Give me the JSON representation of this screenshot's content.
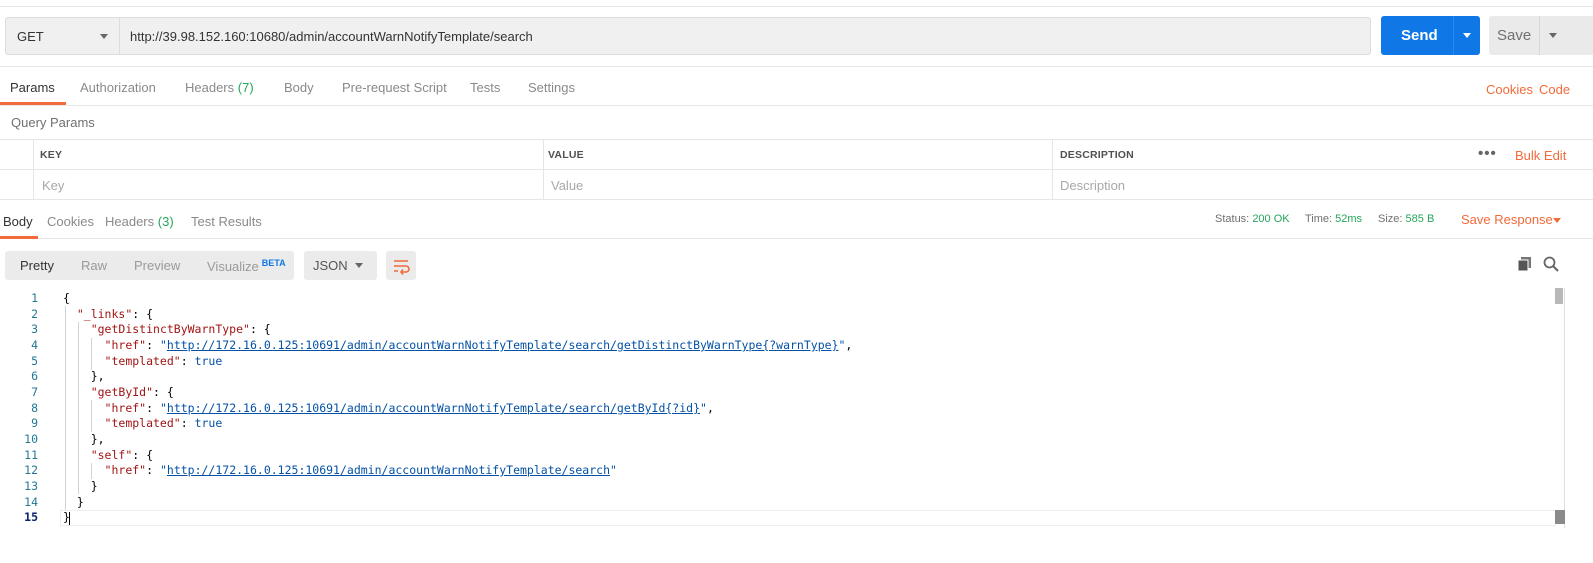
{
  "request": {
    "method": "GET",
    "url": "http://39.98.152.160:10680/admin/accountWarnNotifyTemplate/search",
    "send_label": "Send",
    "save_label": "Save"
  },
  "request_tabs": [
    {
      "label": "Params",
      "count": ""
    },
    {
      "label": "Authorization",
      "count": ""
    },
    {
      "label": "Headers",
      "count": "(7)"
    },
    {
      "label": "Body",
      "count": ""
    },
    {
      "label": "Pre-request Script",
      "count": ""
    },
    {
      "label": "Tests",
      "count": ""
    },
    {
      "label": "Settings",
      "count": ""
    }
  ],
  "request_links": {
    "cookies": "Cookies",
    "code": "Code"
  },
  "query_params": {
    "title": "Query Params",
    "headers": {
      "key": "KEY",
      "value": "VALUE",
      "description": "DESCRIPTION"
    },
    "placeholders": {
      "key": "Key",
      "value": "Value",
      "description": "Description"
    },
    "more": "•••",
    "bulk_edit": "Bulk Edit"
  },
  "response_tabs": [
    {
      "label": "Body",
      "count": ""
    },
    {
      "label": "Cookies",
      "count": ""
    },
    {
      "label": "Headers",
      "count": "(3)"
    },
    {
      "label": "Test Results",
      "count": ""
    }
  ],
  "response_status": {
    "status_label": "Status:",
    "status_value": "200 OK",
    "time_label": "Time:",
    "time_value": "52ms",
    "size_label": "Size:",
    "size_value": "585 B",
    "save_response": "Save Response"
  },
  "viewer": {
    "modes": [
      "Pretty",
      "Raw",
      "Preview",
      "Visualize"
    ],
    "beta": "BETA",
    "format": "JSON"
  },
  "code_lines": [
    "1",
    "2",
    "3",
    "4",
    "5",
    "6",
    "7",
    "8",
    "9",
    "10",
    "11",
    "12",
    "13",
    "14",
    "15"
  ],
  "json": {
    "links_key": "\"_links\"",
    "get_distinct_key": "\"getDistinctByWarnType\"",
    "get_by_id_key": "\"getById\"",
    "self_key": "\"self\"",
    "href_key": "\"href\"",
    "templated_key": "\"templated\"",
    "true_val": "true",
    "href_distinct": "http://172.16.0.125:10691/admin/accountWarnNotifyTemplate/search/getDistinctByWarnType{?warnType}",
    "href_by_id": "http://172.16.0.125:10691/admin/accountWarnNotifyTemplate/search/getById{?id}",
    "href_self": "http://172.16.0.125:10691/admin/accountWarnNotifyTemplate/search"
  },
  "colors": {
    "accent": "#f26b3a",
    "send": "#0f78e6",
    "success": "#25a55b"
  }
}
